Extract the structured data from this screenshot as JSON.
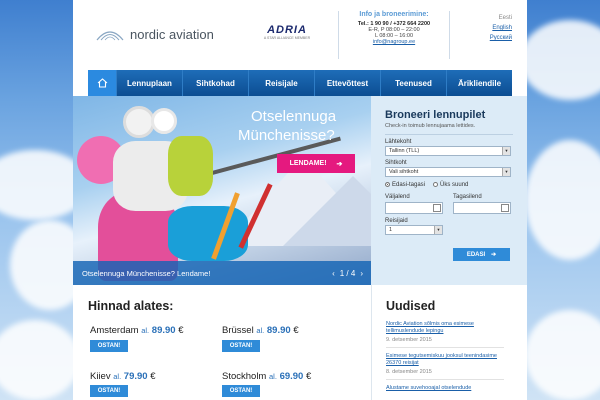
{
  "header": {
    "logo_text": "nordic aviation",
    "partner_logo": "ADRIA",
    "partner_tagline": "A STAR ALLIANCE MEMBER",
    "info": {
      "title": "Info ja broneerimine:",
      "tel": "Tel.: 1 90 90 / +372 664 2200",
      "hours_weekday": "E-R, P 08:00 – 22:00",
      "hours_sat": "L 08:00 – 16:00",
      "email": "info@nagroup.ee"
    },
    "languages": {
      "current": "Eesti",
      "options": [
        "English",
        "Русский"
      ]
    }
  },
  "nav": {
    "home_icon": "home-icon",
    "items": [
      "Lennuplaan",
      "Sihtkohad",
      "Reisijale",
      "Ettevõttest",
      "Teenused",
      "Ärikliendile"
    ]
  },
  "hero": {
    "title_line1": "Otselennuga",
    "title_line2": "Münchenisse?",
    "button_label": "LENDAME!",
    "caption": "Otselennuga Münchenisse? Lendame!",
    "pager": "1 / 4"
  },
  "booking": {
    "title": "Broneeri lennupilet",
    "subtitle": "Check-in toimub lennujaama lettides.",
    "from_label": "Lähtekoht",
    "from_value": "Tallinn (TLL)",
    "to_label": "Sihtkoht",
    "to_value": "Vali sihtkoht",
    "round_trip": "Edasi-tagasi",
    "one_way": "Üks suund",
    "depart_label": "Väljalend",
    "return_label": "Tagasilend",
    "pax_label": "Reisijaid",
    "pax_value": "1",
    "submit_label": "EDASI"
  },
  "prices": {
    "title": "Hinnad alates:",
    "from_word": "al.",
    "currency": "€",
    "buy_label": "OSTAN!",
    "items": [
      {
        "city": "Amsterdam",
        "price": "89.90"
      },
      {
        "city": "Brüssel",
        "price": "89.90"
      },
      {
        "city": "Kiiev",
        "price": "79.90"
      },
      {
        "city": "Stockholm",
        "price": "69.90"
      }
    ]
  },
  "news": {
    "title": "Uudised",
    "items": [
      {
        "text": "Nordic Aviation sõlmis oma esimese tellimuslendude lepingu",
        "date": "9. detsember 2015"
      },
      {
        "text": "Esimese tegutsemiskuu jooksul teenindasime 26370 reisijat",
        "date": "8. detsember 2015"
      },
      {
        "text": "Alustame suvehooajal otselendude",
        "date": ""
      }
    ]
  },
  "colors": {
    "nav": "#0c4d92",
    "accent": "#2f8bd8",
    "hero_button": "#e5197f",
    "booking_bg": "#dcebf7"
  }
}
